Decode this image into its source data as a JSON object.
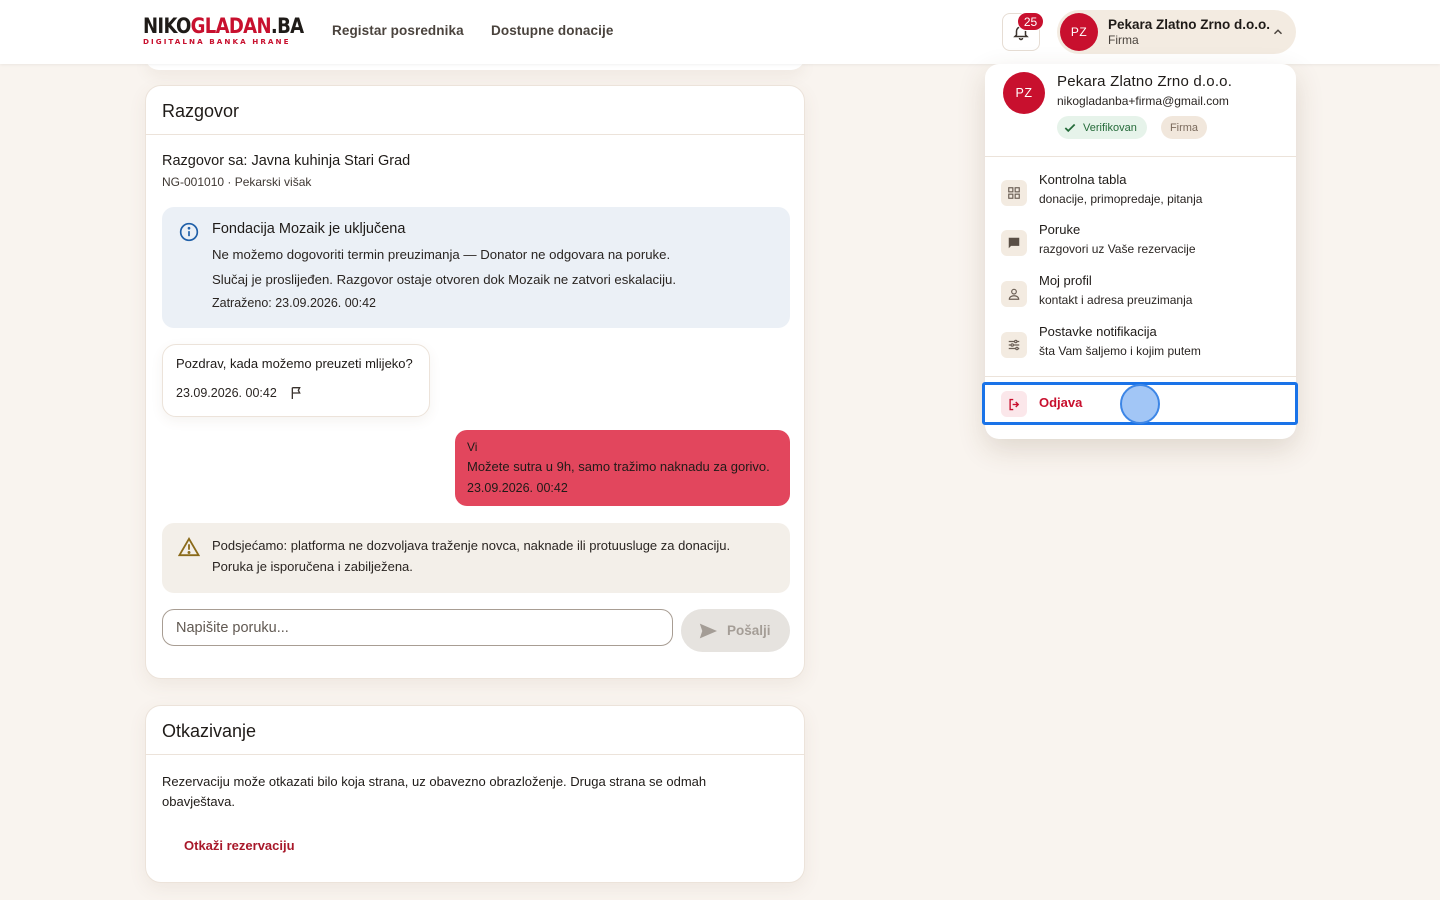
{
  "header": {
    "logo_main_dark": "NIKO",
    "logo_main_red": "GLADAN",
    "logo_main_dark2": ".BA",
    "logo_sub": "DIGITALNA BANKA HRANE",
    "nav": [
      "Registar posrednika",
      "Dostupne donacije"
    ],
    "notifications_count": "25",
    "user_initials": "PZ",
    "user_name": "Pekara Zlatno Zrno d.o.o.",
    "user_role": "Firma"
  },
  "conversation": {
    "title": "Razgovor",
    "with": "Razgovor sa: Javna kuhinja Stari Grad",
    "meta": "NG-001010 · Pekarski višak",
    "info": {
      "title": "Fondacija Mozaik je uključena",
      "line1": "Ne možemo dogovoriti termin preuzimanja — Donator ne odgovara na poruke.",
      "line2": "Slučaj je proslijeđen. Razgovor ostaje otvoren dok Mozaik ne zatvori eskalaciju.",
      "line3": "Zatraženo: 23.09.2026. 00:42"
    },
    "incoming": {
      "text": "Pozdrav, kada možemo preuzeti mlijeko?",
      "time": "23.09.2026. 00:42"
    },
    "outgoing": {
      "author": "Vi",
      "text": "Možete sutra u 9h, samo tražimo naknadu za gorivo.",
      "time": "23.09.2026. 00:42"
    },
    "warning": {
      "line1": "Podsjećamo: platforma ne dozvoljava traženje novca, naknade ili protuusluge za donaciju.",
      "line2": "Poruka je isporučena i zabilježena."
    },
    "input_placeholder": "Napišite poruku...",
    "send_label": "Pošalji"
  },
  "cancellation": {
    "title": "Otkazivanje",
    "text": "Rezervaciju može otkazati bilo koja strana, uz obavezno obrazloženje. Druga strana se odmah obavještava.",
    "link": "Otkaži rezervaciju"
  },
  "dropdown": {
    "initials": "PZ",
    "name": "Pekara Zlatno Zrno d.o.o.",
    "email": "nikogladanba+firma@gmail.com",
    "badge_verified": "Verifikovan",
    "badge_role": "Firma",
    "items": [
      {
        "title": "Kontrolna tabla",
        "subtitle": "donacije, primopredaje, pitanja",
        "icon": "dashboard-icon"
      },
      {
        "title": "Poruke",
        "subtitle": "razgovori uz Vaše rezervacije",
        "icon": "chat-icon"
      },
      {
        "title": "Moj profil",
        "subtitle": "kontakt i adresa preuzimanja",
        "icon": "person-icon"
      },
      {
        "title": "Postavke notifikacija",
        "subtitle": "šta Vam šaljemo i kojim putem",
        "icon": "tune-icon"
      }
    ],
    "logout": "Odjava"
  },
  "colors": {
    "brand_red": "#c8102e",
    "outgoing_bubble": "#e2465d",
    "background": "#f9f4ef",
    "highlight": "#1a73e8"
  }
}
